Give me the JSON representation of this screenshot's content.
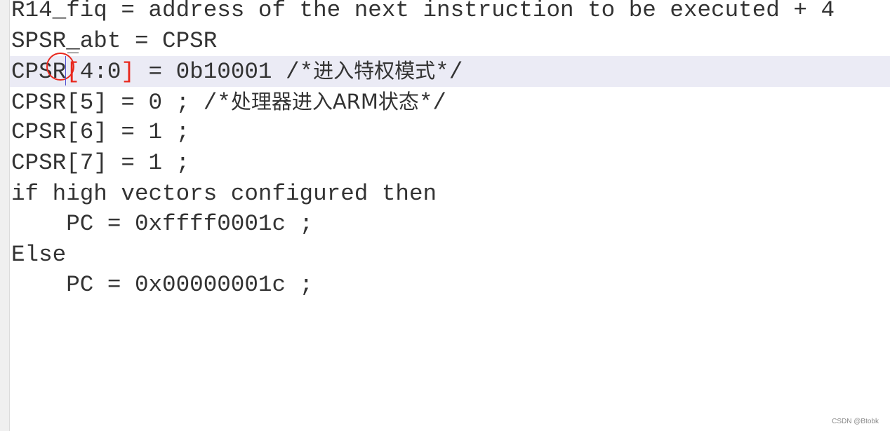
{
  "code_lines": [
    {
      "text": "R14_fiq = address of the next instruction to be executed + 4"
    },
    {
      "text": "SPSR_abt = CPSR"
    },
    {
      "pre": "CPSR",
      "red_open": "[",
      "mid": "4:0",
      "red_close": "]",
      "post": " = 0b10001 /*",
      "cjk": "进入特权模式",
      "end": "*/"
    },
    {
      "text": "CPSR[5] = 0 ; /*",
      "cjk": "处理器进入",
      "mid": "ARM",
      "cjk2": "状态",
      "end": "*/"
    },
    {
      "text": "CPSR[6] = 1 ;"
    },
    {
      "text": "CPSR[7] = 1 ;"
    },
    {
      "text": "if high vectors configured then"
    },
    {
      "text": "    PC = 0xffff0001c ;"
    },
    {
      "text": "Else"
    },
    {
      "text": "    PC = 0x00000001c ;"
    }
  ],
  "highlighted_line": 3,
  "watermark": "CSDN @Btobk",
  "colors": {
    "highlight": "#ebebf5",
    "accent_red": "#e8281e",
    "text": "#333333"
  }
}
